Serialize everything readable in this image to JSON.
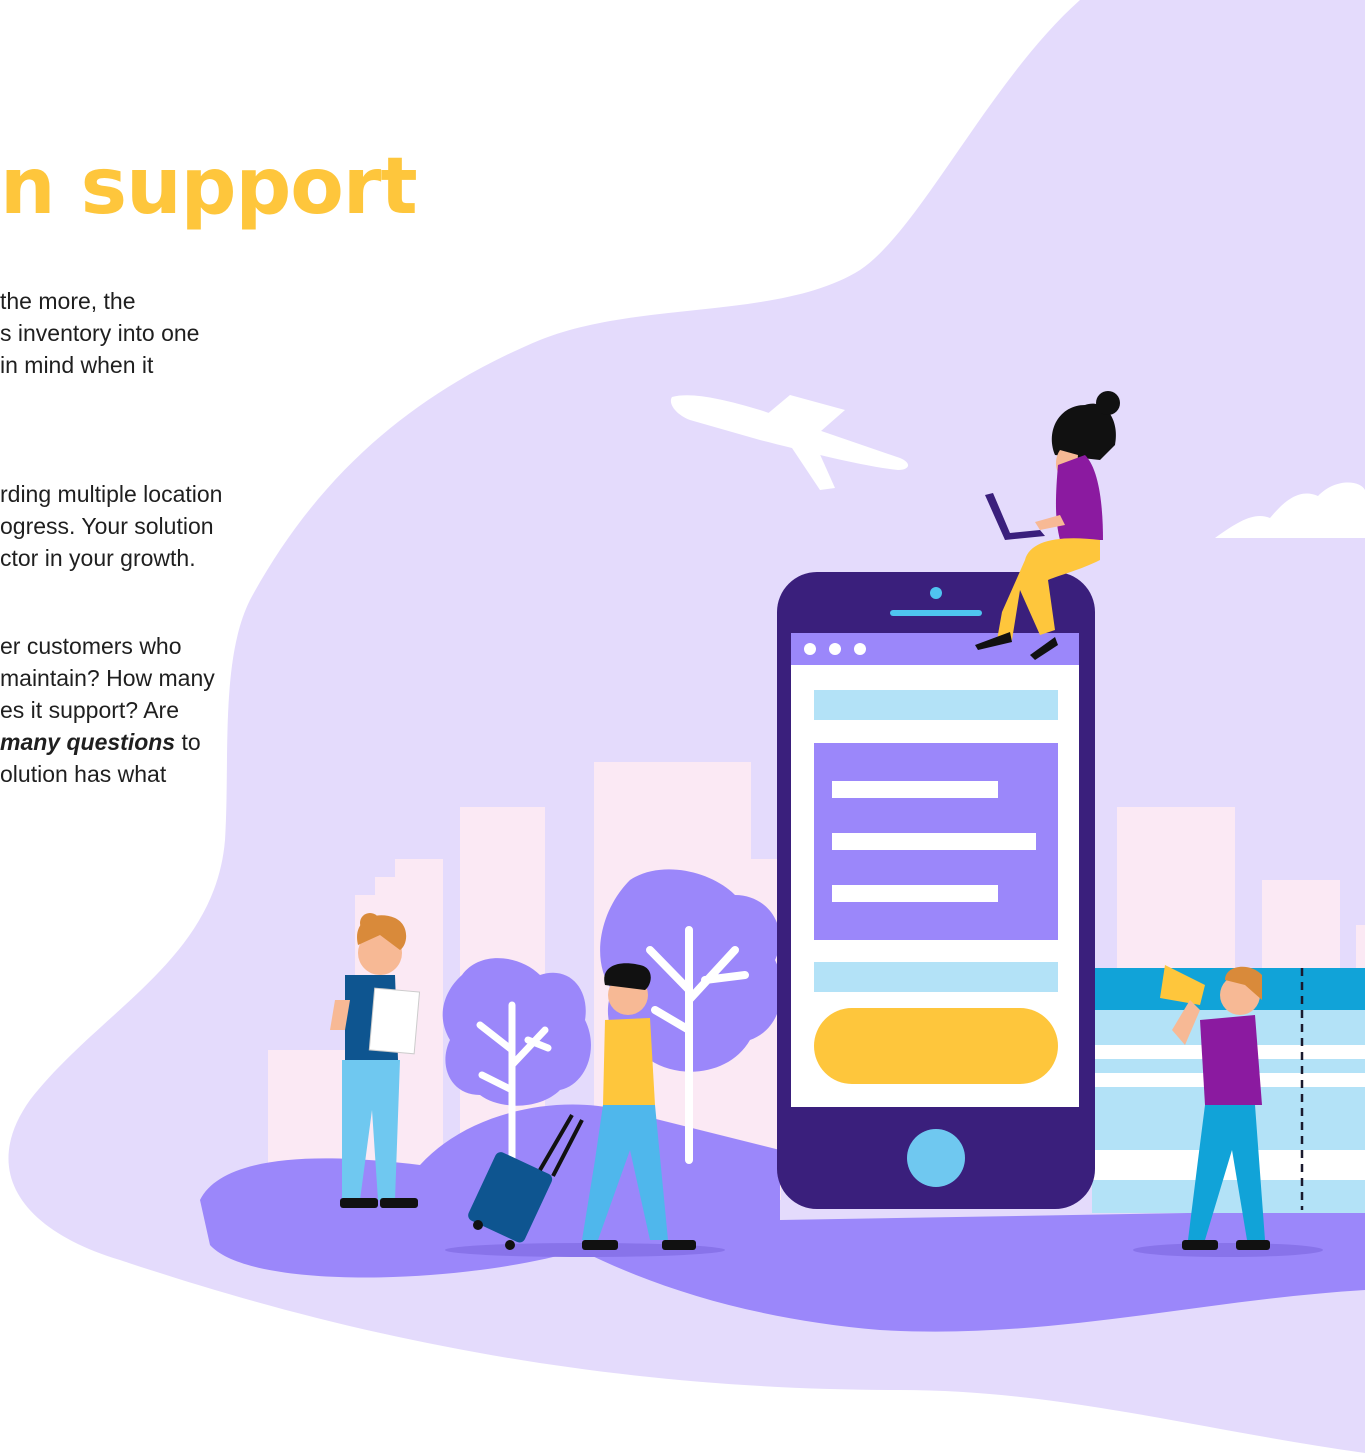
{
  "section": {
    "heading": "n support",
    "paragraphs": [
      {
        "lines": [
          "the more, the",
          "s inventory into one",
          "in mind when it"
        ]
      },
      {
        "lines": [
          "rding multiple location",
          "ogress. Your solution",
          "ctor in your growth."
        ]
      },
      {
        "lines_before": [
          "er customers who",
          "maintain? How many",
          "es it support? Are"
        ],
        "emphasis": "many questions",
        "after_emphasis": " to",
        "lines_after": [
          "olution has what"
        ]
      }
    ]
  },
  "illustration": {
    "colors": {
      "blob": "#e4dbfc",
      "building": "#fbe9f4",
      "ground": "#9b87fa",
      "phone_frame": "#3a1f7c",
      "accent_yellow": "#fec63c",
      "light_blue": "#b3e2f7"
    },
    "icons": [
      "airplane-icon",
      "cloud-icon",
      "phone-icon",
      "tree-icon",
      "megaphone-icon",
      "suitcase-icon"
    ]
  }
}
